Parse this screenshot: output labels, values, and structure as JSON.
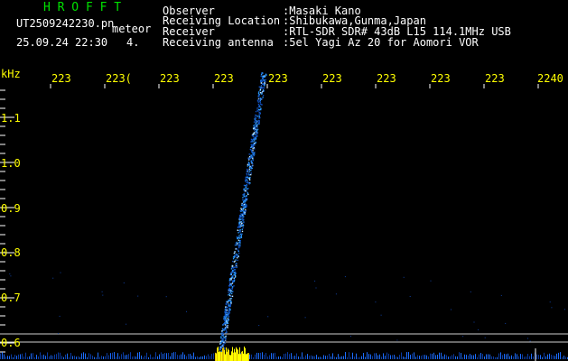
{
  "header": {
    "app_name": "H R O F F T",
    "file_name": "UT2509242230.pn",
    "mode": "meteor",
    "datetime": "25.09.24 22:30",
    "count": "4.",
    "info": [
      {
        "label": "Observer",
        "value": ":Masaki Kano"
      },
      {
        "label": "Receiving Location",
        "value": ":Shibukawa,Gunma,Japan"
      },
      {
        "label": "Receiver",
        "value": ":RTL-SDR SDR# 43dB L15 114.1MHz USB"
      },
      {
        "label": "Receiving antenna",
        "value": ":5el Yagi Az 20 for Aomori VOR"
      }
    ]
  },
  "axis": {
    "unit": "kHz",
    "time_labels": [
      "223",
      "223(",
      "223",
      "223",
      "223",
      "223",
      "223",
      "223",
      "223",
      "2240"
    ],
    "freq_labels": [
      "1.1",
      "1.0",
      "0.9",
      "0.8",
      "0.7",
      "0.6"
    ]
  },
  "colors": {
    "header_title": "#00e000",
    "label_text": "#ffffff",
    "axis_label": "#ffff00",
    "meteor_trail": "#2a9bff",
    "signal_peak": "#ffff00"
  }
}
